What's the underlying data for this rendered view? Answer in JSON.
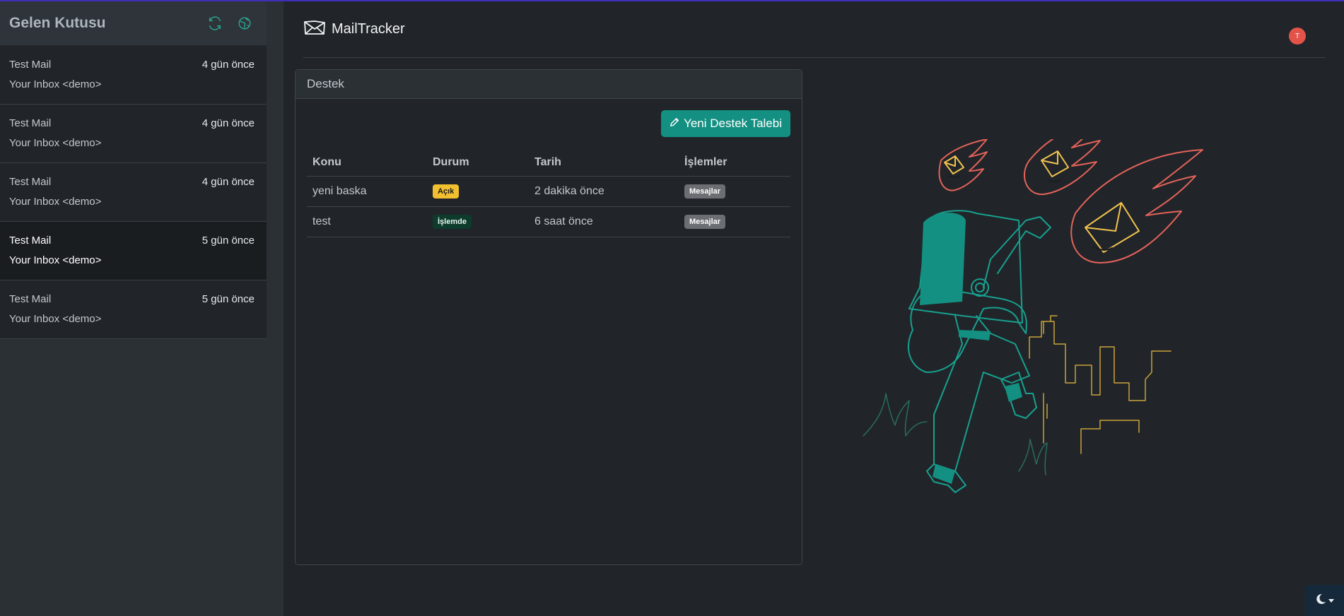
{
  "sidebar": {
    "title": "Gelen Kutusu",
    "icons": [
      "refresh-icon",
      "globe-icon"
    ],
    "mails": [
      {
        "subject": "Test Mail",
        "time": "4 gün önce",
        "from": "Your Inbox <demo>"
      },
      {
        "subject": "Test Mail",
        "time": "4 gün önce",
        "from": "Your Inbox <demo>"
      },
      {
        "subject": "Test Mail",
        "time": "4 gün önce",
        "from": "Your Inbox <demo>"
      },
      {
        "subject": "Test Mail",
        "time": "5 gün önce",
        "from": "Your Inbox <demo>"
      },
      {
        "subject": "Test Mail",
        "time": "5 gün önce",
        "from": "Your Inbox <demo>"
      }
    ]
  },
  "header": {
    "brand": "MailTracker",
    "avatar_initial": "T"
  },
  "support": {
    "card_title": "Destek",
    "new_button": "Yeni Destek Talebi",
    "columns": {
      "subject": "Konu",
      "status": "Durum",
      "date": "Tarih",
      "actions": "İşlemler"
    },
    "rows": [
      {
        "subject": "yeni baska",
        "status": "Açık",
        "date": "2 dakika önce",
        "action": "Mesajlar"
      },
      {
        "subject": "test",
        "status": "İşlemde",
        "date": "6 saat önce",
        "action": "Mesajlar"
      }
    ]
  },
  "colors": {
    "accent": "#139082",
    "warning": "#f2c02e",
    "success_dark": "#0d3b2c",
    "avatar": "#e4534a"
  }
}
